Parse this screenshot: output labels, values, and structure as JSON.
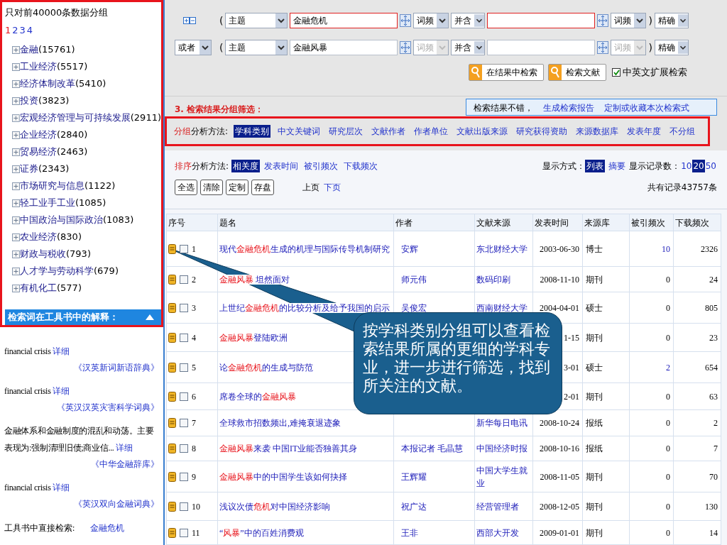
{
  "sidebar": {
    "header": "只对前40000条数据分组",
    "pages": [
      {
        "label": "1",
        "selected": true
      },
      {
        "label": "2",
        "selected": false
      },
      {
        "label": "3",
        "selected": false
      },
      {
        "label": "4",
        "selected": false
      }
    ],
    "categories": [
      {
        "label": "金融",
        "count": "(15761)"
      },
      {
        "label": "工业经济",
        "count": "(5517)"
      },
      {
        "label": "经济体制改革",
        "count": "(5410)"
      },
      {
        "label": "投资",
        "count": "(3823)"
      },
      {
        "label": "宏观经济管理与可持续发展",
        "count": "(2911)"
      },
      {
        "label": "企业经济",
        "count": "(2840)"
      },
      {
        "label": "贸易经济",
        "count": "(2463)"
      },
      {
        "label": "证券",
        "count": "(2343)"
      },
      {
        "label": "市场研究与信息",
        "count": "(1122)"
      },
      {
        "label": "轻工业手工业",
        "count": "(1085)"
      },
      {
        "label": "中国政治与国际政治",
        "count": "(1083)"
      },
      {
        "label": "农业经济",
        "count": "(830)"
      },
      {
        "label": "财政与税收",
        "count": "(793)"
      },
      {
        "label": "人才学与劳动科学",
        "count": "(679)"
      },
      {
        "label": "有机化工",
        "count": "(577)"
      }
    ],
    "dict_title": "检索词在工具书中的解释：",
    "dict_entries": [
      {
        "text": "financial crisis",
        "link": "详细",
        "source": "《汉英新词新语辞典》"
      },
      {
        "text": "financial crisis",
        "link": "详细",
        "source": "《英汉汉英灾害科学词典》"
      },
      {
        "text": "金融体系和金融制度的混乱和动荡。主要表现为:强制清理旧债;商业信...",
        "link": "详细",
        "source": "《中华金融辞库》"
      },
      {
        "text": "financial crisis",
        "link": "详细",
        "source": "《英汉双向金融词典》"
      }
    ],
    "direct_search": {
      "label": "工具书中直接检索:",
      "link": "金融危机"
    }
  },
  "search_rows": [
    {
      "logic": null,
      "open": "(",
      "close": ")",
      "field": "主题",
      "term": "金融危机",
      "freq": "词频",
      "freq_disabled": false,
      "relation": "并含",
      "term2": "",
      "freq2": "词频",
      "freq2_disabled": false,
      "precision": "精确"
    },
    {
      "logic": "或者",
      "open": "(",
      "close": ")",
      "field": "主题",
      "term": "金融风暴",
      "freq": "词频",
      "freq_disabled": true,
      "relation": "并含",
      "term2": "",
      "freq2": "词频",
      "freq2_disabled": true,
      "precision": "精确"
    }
  ],
  "search_buttons": [
    "在结果中检索",
    "检索文献"
  ],
  "extend_checkbox": {
    "label": "中英文扩展检索",
    "checked": true
  },
  "section_title": "3. 检索结果分组筛选：",
  "notice": {
    "text": "检索结果不错，",
    "links": [
      "生成检索报告",
      "定制或收藏本次检索式"
    ]
  },
  "group": {
    "prefix": "分组",
    "label": "分析方法:",
    "options": [
      {
        "label": "学科类别",
        "selected": true
      },
      {
        "label": "中文关键词",
        "selected": false
      },
      {
        "label": "研究层次",
        "selected": false
      },
      {
        "label": "文献作者",
        "selected": false
      },
      {
        "label": "作者单位",
        "selected": false
      },
      {
        "label": "文献出版来源",
        "selected": false
      },
      {
        "label": "研究获得资助",
        "selected": false
      },
      {
        "label": "来源数据库",
        "selected": false
      },
      {
        "label": "发表年度",
        "selected": false
      },
      {
        "label": "不分组",
        "selected": false
      }
    ]
  },
  "sort": {
    "prefix": "排序",
    "label": "分析方法:",
    "options": [
      {
        "label": "相关度",
        "selected": true
      },
      {
        "label": "发表时间",
        "selected": false
      },
      {
        "label": "被引频次",
        "selected": false
      },
      {
        "label": "下载频次",
        "selected": false
      }
    ]
  },
  "display": {
    "label": "显示方式：",
    "modes": [
      {
        "label": "列表",
        "selected": true
      },
      {
        "label": "摘要",
        "selected": false
      }
    ],
    "count_label": "显示记录数：",
    "counts": [
      {
        "label": "10",
        "selected": false
      },
      {
        "label": "20",
        "selected": true
      },
      {
        "label": "50",
        "selected": false
      }
    ]
  },
  "actions": [
    "全选",
    "清除",
    "定制",
    "存盘"
  ],
  "pager": [
    {
      "label": "上页",
      "disabled": true
    },
    {
      "label": "下页",
      "disabled": false
    }
  ],
  "total": "共有记录43757条",
  "table": {
    "columns": [
      "序号",
      "题名",
      "作者",
      "文献来源",
      "发表时间",
      "来源库",
      "被引频次",
      "下载频次"
    ],
    "rows": [
      {
        "no": "1",
        "checked": false,
        "title": [
          {
            "t": "现代",
            "hit": false
          },
          {
            "t": "金融危机",
            "hit": true
          },
          {
            "t": "生成的机理与国际传导机制研究",
            "hit": false
          }
        ],
        "author": "安辉",
        "source": "东北财经大学",
        "date": "2003-06-30",
        "db": "博士",
        "cited": "10",
        "cited_link": true,
        "downloads": "2326"
      },
      {
        "no": "2",
        "checked": false,
        "title": [
          {
            "t": "金融风暴",
            "hit": true
          },
          {
            "t": " 坦然面对",
            "hit": false
          }
        ],
        "author": "师元伟",
        "source": "数码印刷",
        "date": "2008-11-10",
        "db": "期刊",
        "cited": "0",
        "cited_link": false,
        "downloads": "24"
      },
      {
        "no": "3",
        "checked": false,
        "title": [
          {
            "t": "上世纪",
            "hit": false
          },
          {
            "t": "金融危机",
            "hit": true
          },
          {
            "t": "的比较分析及给予我国的启示",
            "hit": false
          }
        ],
        "author": "吴俊宏",
        "source": "西南财经大学",
        "date": "2004-04-01",
        "db": "硕士",
        "cited": "0",
        "cited_link": false,
        "downloads": "805"
      },
      {
        "no": "4",
        "checked": false,
        "title": [
          {
            "t": "金融风暴",
            "hit": true
          },
          {
            "t": "登陆欧洲",
            "hit": false
          }
        ],
        "author": "",
        "source": "",
        "date": "1-15",
        "db": "期刊",
        "cited": "0",
        "cited_link": false,
        "downloads": "23"
      },
      {
        "no": "5",
        "checked": false,
        "title": [
          {
            "t": "论",
            "hit": false
          },
          {
            "t": "金融危机",
            "hit": true
          },
          {
            "t": "的生成与防范",
            "hit": false
          }
        ],
        "author": "",
        "source": "",
        "date": "3-01",
        "db": "硕士",
        "cited": "2",
        "cited_link": true,
        "downloads": "654"
      },
      {
        "no": "6",
        "checked": false,
        "title": [
          {
            "t": "席卷全球的",
            "hit": false
          },
          {
            "t": "金融风暴",
            "hit": true
          }
        ],
        "author": "",
        "source": "",
        "date": "2-01",
        "db": "期刊",
        "cited": "0",
        "cited_link": false,
        "downloads": "63"
      },
      {
        "no": "7",
        "checked": false,
        "title": [
          {
            "t": "全球救市招数频出,难掩衰退迹象",
            "hit": false
          }
        ],
        "author": "",
        "source": "新华每日电讯",
        "date": "2008-10-24",
        "db": "报纸",
        "cited": "0",
        "cited_link": false,
        "downloads": "2"
      },
      {
        "no": "8",
        "checked": false,
        "title": [
          {
            "t": "金融风暴",
            "hit": true
          },
          {
            "t": "来袭 中国IT业能否独善其身",
            "hit": false
          }
        ],
        "author": "本报记者 毛晶慧",
        "source": "中国经济时报",
        "date": "2008-10-16",
        "db": "报纸",
        "cited": "0",
        "cited_link": false,
        "downloads": "7"
      },
      {
        "no": "9",
        "checked": false,
        "title": [
          {
            "t": "金融风暴",
            "hit": true
          },
          {
            "t": "中的中国学生该如何抉择",
            "hit": false
          }
        ],
        "author": "王辉耀",
        "source": "中国大学生就业",
        "date": "2008-11-05",
        "db": "期刊",
        "cited": "0",
        "cited_link": false,
        "downloads": "70"
      },
      {
        "no": "10",
        "checked": false,
        "title": [
          {
            "t": "浅议次债",
            "hit": false
          },
          {
            "t": "危机",
            "hit": true
          },
          {
            "t": "对中国经济影响",
            "hit": false
          }
        ],
        "author": "祝广达",
        "source": "经营管理者",
        "date": "2008-12-05",
        "db": "期刊",
        "cited": "0",
        "cited_link": false,
        "downloads": "130"
      },
      {
        "no": "11",
        "checked": false,
        "title": [
          {
            "t": "“",
            "hit": false
          },
          {
            "t": "风暴",
            "hit": true
          },
          {
            "t": "”中的百姓消费观",
            "hit": false
          }
        ],
        "author": "王非",
        "source": "西部大开发",
        "date": "2009-01-01",
        "db": "期刊",
        "cited": "0",
        "cited_link": false,
        "downloads": "14"
      }
    ]
  },
  "callout": "按学科类别分组可以查看检索结果所属的更细的学科专业，进一步进行筛选，找到所关注的文献。"
}
